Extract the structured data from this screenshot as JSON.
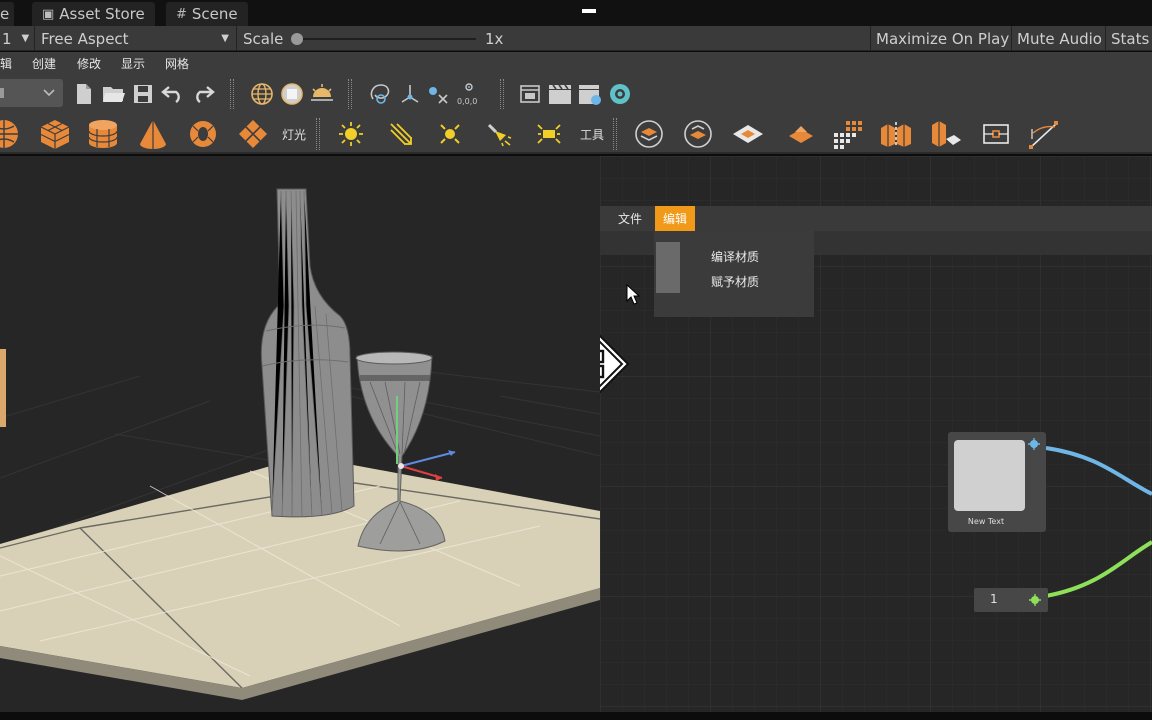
{
  "tabs": [
    {
      "label": "e"
    },
    {
      "label": "Asset Store",
      "icon": "shopping-bag-icon"
    },
    {
      "label": "Scene",
      "icon": "grid-hash-icon"
    }
  ],
  "game_toolbar": {
    "display_value": "1",
    "aspect_value": "Free Aspect",
    "scale_label": "Scale",
    "scale_value": "1x",
    "maximize_on_play": "Maximize On Play",
    "mute_audio": "Mute Audio",
    "stats": "Stats"
  },
  "menubar": {
    "items": [
      "辑",
      "创建",
      "修改",
      "显示",
      "网格"
    ]
  },
  "toolbar1": {
    "icons": [
      "dropdown-box-icon",
      "new-file-icon",
      "open-folder-icon",
      "save-icon",
      "undo-icon",
      "redo-icon",
      "globe-icon",
      "globe-fill-icon",
      "sun-globe-icon",
      "lasso-icon",
      "pivot-icon",
      "connect-icon",
      "vertex-icon",
      "window-icon",
      "clapper-icon",
      "clapper-settings-icon",
      "record-icon"
    ]
  },
  "toolbar2": {
    "icons": [
      "sphere-icon",
      "cube-icon",
      "cylinder-icon",
      "cone-icon",
      "torus-icon",
      "plane-icon",
      "point-light-icon",
      "directional-light-icon",
      "sun-light-icon",
      "spot-light-icon",
      "area-light-icon",
      "layer-stack-icon",
      "layer-move-icon",
      "diamond-plane-icon",
      "diamond-small-icon",
      "grid-block-icon",
      "split-box-icon",
      "tall-box-icon",
      "bounding-box-icon",
      "pen-curve-icon"
    ],
    "light_label": "灯光",
    "tools_label": "工具"
  },
  "node_editor": {
    "menu_file": "文件",
    "menu_edit": "编辑",
    "dropdown_items": [
      "编译材质",
      "赋予材质"
    ],
    "texture_node_label": "New Text",
    "value_node_value": "1"
  },
  "colors": {
    "accent": "#f19a1a",
    "orange_icon": "#e8893a",
    "floor": "#d9d2ba",
    "link_blue": "#6fb6e6",
    "link_green": "#8ee05a"
  }
}
